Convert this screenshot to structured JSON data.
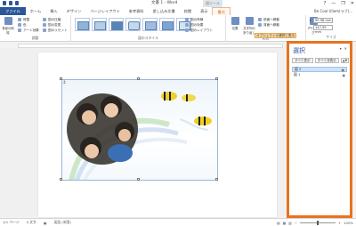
{
  "window": {
    "title": "文書 1 - Word",
    "context_tab_header": "図ツール",
    "controls": [
      "?",
      "—",
      "❐",
      "✕"
    ]
  },
  "tabs": [
    {
      "label": "ファイル",
      "kind": "file"
    },
    {
      "label": "ホーム"
    },
    {
      "label": "挿入"
    },
    {
      "label": "デザイン"
    },
    {
      "label": "ページレイアウト"
    },
    {
      "label": "参考資料"
    },
    {
      "label": "差し込み文書"
    },
    {
      "label": "校閲"
    },
    {
      "label": "表示"
    },
    {
      "label": "書式",
      "kind": "ctx"
    }
  ],
  "user": "Be Cool Uliem(ラブ)...",
  "ribbon": {
    "adjust": {
      "big_button": "背景の削除",
      "items": [
        "修整",
        "色",
        "アート効果"
      ],
      "items2": [
        "図の圧縮",
        "図の変更",
        "図のリセット"
      ],
      "label": "調整"
    },
    "styles": {
      "label": "図のスタイル",
      "side": [
        "図の枠線",
        "図の効果",
        "図のレイアウト"
      ]
    },
    "arrange": {
      "label": "配置",
      "position": "位置",
      "wrap": "文字列の折り返し",
      "items": [
        "前面へ移動",
        "背面へ移動"
      ],
      "selection_pane_button": "オブジェクトの選択と表示"
    },
    "size": {
      "label": "サイズ",
      "trim": "トリミング",
      "height": "90.98 mm",
      "width": "147.99 mm"
    }
  },
  "selection_pane": {
    "title": "選択",
    "show_all": "すべて表示",
    "hide_all": "すべて非表示",
    "arrows": "▲▼",
    "items": [
      {
        "label": "図 2",
        "selected": true
      },
      {
        "label": "図 1",
        "selected": false
      }
    ]
  },
  "status": {
    "page": "1/1 ページ",
    "words": "0 文字",
    "lang": "英語 (米国)",
    "zoom": "100%"
  }
}
